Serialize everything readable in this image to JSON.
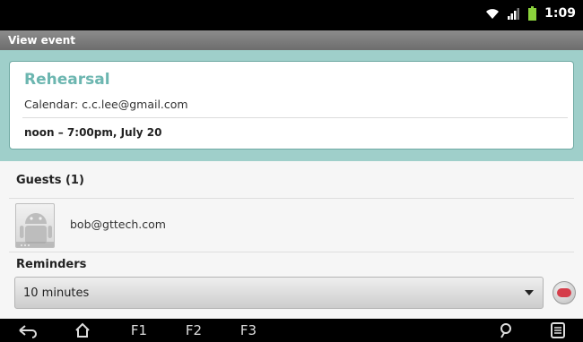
{
  "status_bar": {
    "time": "1:09",
    "icons": [
      "wifi-icon",
      "signal-icon",
      "battery-icon"
    ]
  },
  "header": {
    "title": "View event"
  },
  "event": {
    "title": "Rehearsal",
    "calendar": "Calendar: c.c.lee@gmail.com",
    "datetime": "noon – 7:00pm, July 20"
  },
  "guests": {
    "header": "Guests (1)",
    "items": [
      {
        "email": "bob@gttech.com",
        "avatar": "android-avatar-icon"
      }
    ]
  },
  "reminders": {
    "header": "Reminders",
    "selected": "10 minutes"
  },
  "nav_bar": {
    "f1": "F1",
    "f2": "F2",
    "f3": "F3",
    "icons": [
      "back-icon",
      "home-icon",
      "search-icon",
      "menu-icon"
    ]
  },
  "colors": {
    "accent": "#6cb6b0",
    "band": "#9fcfca",
    "remove": "#d53d4a"
  }
}
